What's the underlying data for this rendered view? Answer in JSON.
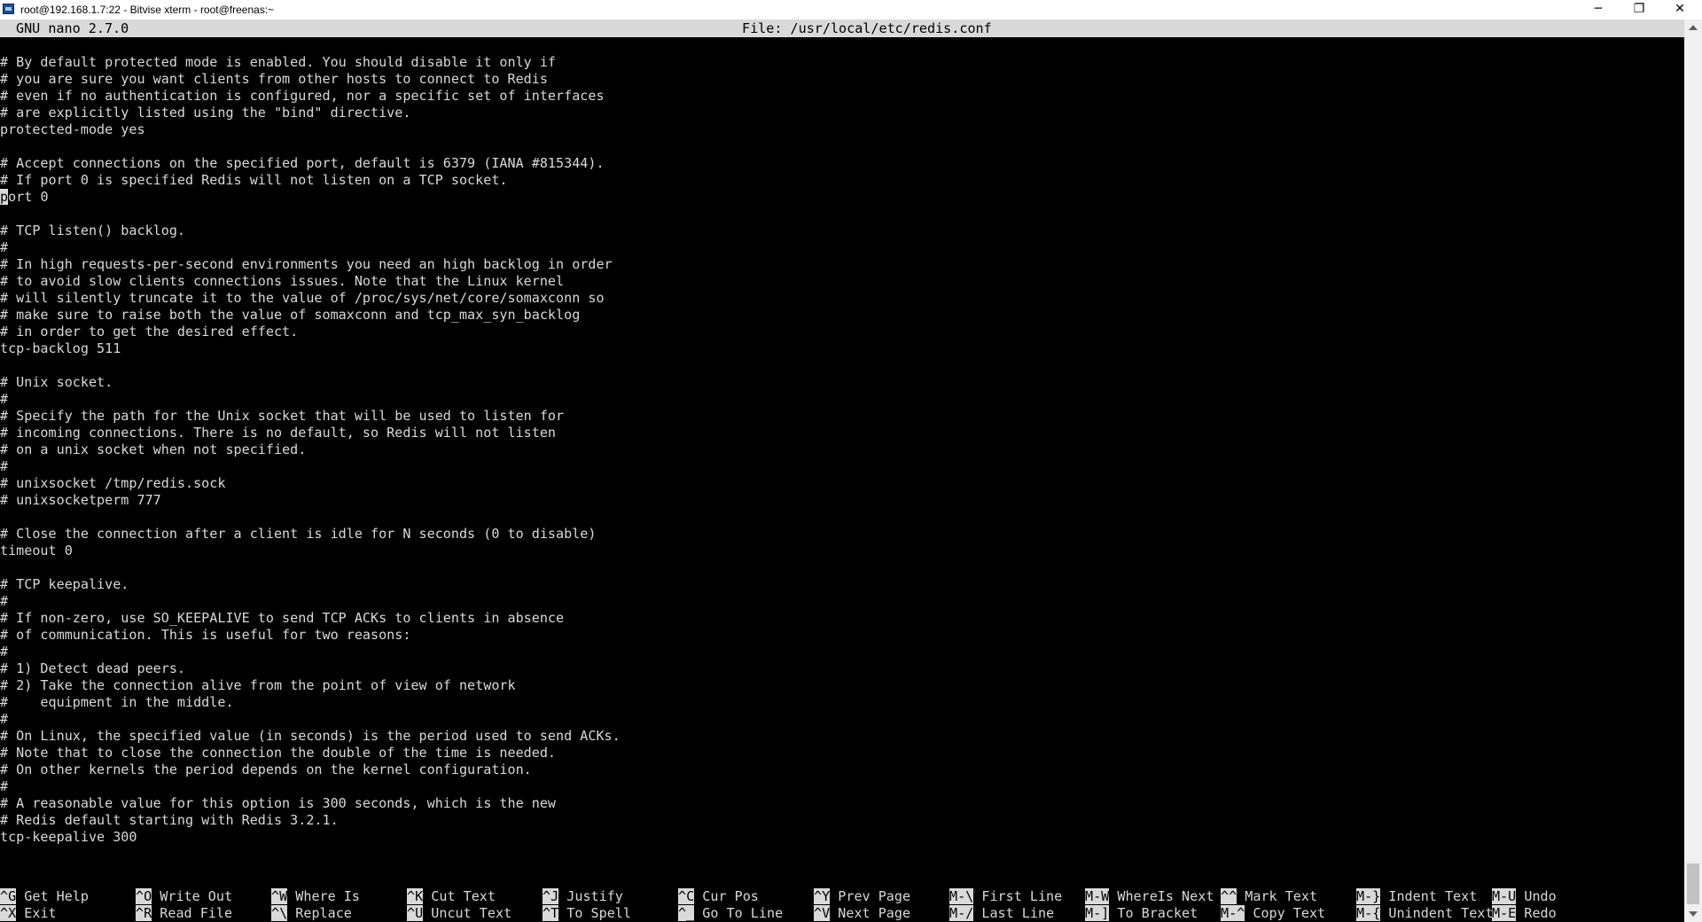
{
  "window": {
    "title": "root@192.168.1.7:22 - Bitvise xterm - root@freenas:~",
    "minimize_glyph": "─",
    "restore_glyph": "❐",
    "close_glyph": "✕"
  },
  "nano": {
    "version": "GNU nano 2.7.0",
    "file_label": "File: /usr/local/etc/redis.conf"
  },
  "editor": {
    "cursor_char": "p",
    "lines": [
      "",
      "# By default protected mode is enabled. You should disable it only if",
      "# you are sure you want clients from other hosts to connect to Redis",
      "# even if no authentication is configured, nor a specific set of interfaces",
      "# are explicitly listed using the \"bind\" directive.",
      "protected-mode yes",
      "",
      "# Accept connections on the specified port, default is 6379 (IANA #815344).",
      "# If port 0 is specified Redis will not listen on a TCP socket.",
      "ort 0",
      "",
      "# TCP listen() backlog.",
      "#",
      "# In high requests-per-second environments you need an high backlog in order",
      "# to avoid slow clients connections issues. Note that the Linux kernel",
      "# will silently truncate it to the value of /proc/sys/net/core/somaxconn so",
      "# make sure to raise both the value of somaxconn and tcp_max_syn_backlog",
      "# in order to get the desired effect.",
      "tcp-backlog 511",
      "",
      "# Unix socket.",
      "#",
      "# Specify the path for the Unix socket that will be used to listen for",
      "# incoming connections. There is no default, so Redis will not listen",
      "# on a unix socket when not specified.",
      "#",
      "# unixsocket /tmp/redis.sock",
      "# unixsocketperm 777",
      "",
      "# Close the connection after a client is idle for N seconds (0 to disable)",
      "timeout 0",
      "",
      "# TCP keepalive.",
      "#",
      "# If non-zero, use SO_KEEPALIVE to send TCP ACKs to clients in absence",
      "# of communication. This is useful for two reasons:",
      "#",
      "# 1) Detect dead peers.",
      "# 2) Take the connection alive from the point of view of network",
      "#    equipment in the middle.",
      "#",
      "# On Linux, the specified value (in seconds) is the period used to send ACKs.",
      "# Note that to close the connection the double of the time is needed.",
      "# On other kernels the period depends on the kernel configuration.",
      "#",
      "# A reasonable value for this option is 300 seconds, which is the new",
      "# Redis default starting with Redis 3.2.1.",
      "tcp-keepalive 300"
    ]
  },
  "shortcuts": [
    {
      "key": "^G",
      "label": "Get Help"
    },
    {
      "key": "^O",
      "label": "Write Out"
    },
    {
      "key": "^W",
      "label": "Where Is"
    },
    {
      "key": "^K",
      "label": "Cut Text"
    },
    {
      "key": "^J",
      "label": "Justify"
    },
    {
      "key": "^C",
      "label": "Cur Pos"
    },
    {
      "key": "^Y",
      "label": "Prev Page"
    },
    {
      "key": "M-\\",
      "label": "First Line"
    },
    {
      "key": "M-W",
      "label": "WhereIs Next"
    },
    {
      "key": "^^",
      "label": "Mark Text"
    },
    {
      "key": "M-}",
      "label": "Indent Text"
    },
    {
      "key": "M-U",
      "label": "Undo"
    },
    {
      "key": "^X",
      "label": "Exit"
    },
    {
      "key": "^R",
      "label": "Read File"
    },
    {
      "key": "^\\",
      "label": "Replace"
    },
    {
      "key": "^U",
      "label": "Uncut Text"
    },
    {
      "key": "^T",
      "label": "To Spell"
    },
    {
      "key": "^_",
      "label": "Go To Line"
    },
    {
      "key": "^V",
      "label": "Next Page"
    },
    {
      "key": "M-/",
      "label": "Last Line"
    },
    {
      "key": "M-]",
      "label": "To Bracket"
    },
    {
      "key": "M-^",
      "label": "Copy Text"
    },
    {
      "key": "M-{",
      "label": "Unindent Text"
    },
    {
      "key": "M-E",
      "label": "Redo"
    }
  ]
}
